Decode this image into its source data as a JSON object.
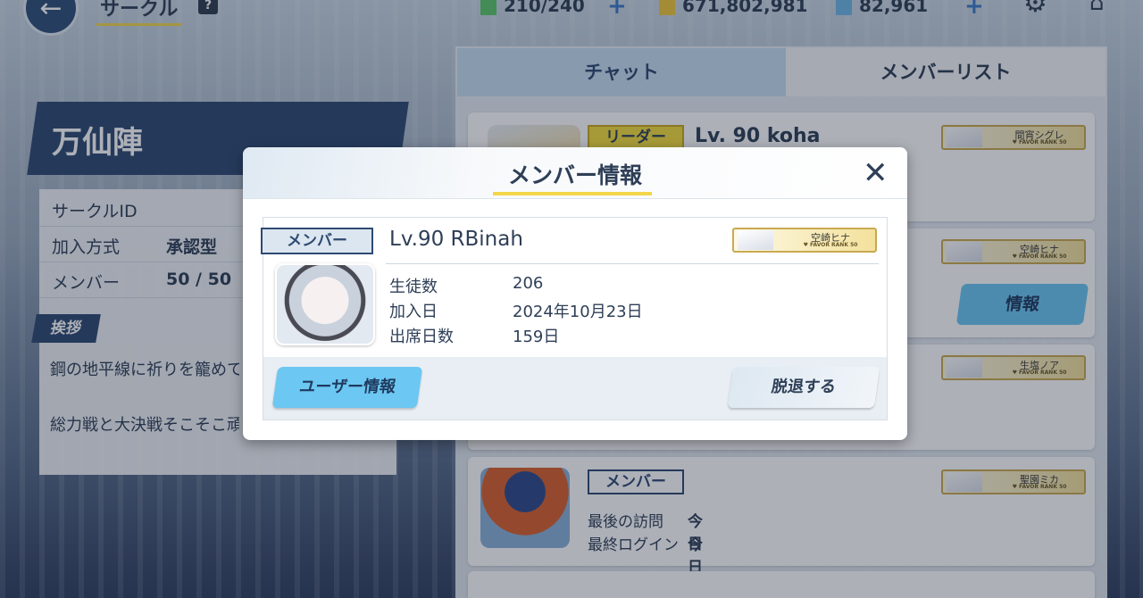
{
  "topbar": {
    "back_icon": "←",
    "title": "サークル",
    "help_icon": "?",
    "ap": "210/240",
    "credits": "671,802,981",
    "pyroxene": "82,961",
    "plus": "+",
    "settings_icon": "⚙",
    "home_icon": "⌂"
  },
  "circle": {
    "name": "万仙陣",
    "id_label": "サークルID",
    "join_label": "加入方式",
    "join_value": "承認型",
    "members_label": "メンバー",
    "members_value": "50 / 50",
    "greeting_label": "挨拶",
    "greeting_lines": [
      "鋼の地平線に祈りを籠めて",
      "総力戦と大決戦そこそこ頑"
    ]
  },
  "tabs": {
    "chat": "チャット",
    "members": "メンバーリスト"
  },
  "member_list": [
    {
      "role": "リーダー",
      "name": "Lv. 90 koha",
      "favor_student": "間宵シグレ"
    },
    {
      "favor_student": "空崎ヒナ",
      "info_button": "情報"
    },
    {
      "favor_student": "生塩ノア"
    },
    {
      "role": "メンバー",
      "favor_student": "聖園ミカ",
      "last_visit_label": "最後の訪問",
      "last_visit_value": "今日",
      "last_login_label": "最終ログイン",
      "last_login_value": "今日"
    }
  ],
  "favor_rank_text": "♥ FAVOR RANK 50",
  "modal": {
    "title": "メンバー情報",
    "close_icon": "✕",
    "role": "メンバー",
    "name": "Lv.90 RBinah",
    "favor_student": "空崎ヒナ",
    "students_label": "生徒数",
    "students_value": "206",
    "joined_label": "加入日",
    "joined_value": "2024年10月23日",
    "attendance_label": "出席日数",
    "attendance_value": "159日",
    "user_info_button": "ユーザー情報",
    "leave_button": "脱退する"
  },
  "colors": {
    "navy": "#2e4a72",
    "accent_yellow": "#f3d64a",
    "button_blue": "#6cc7f2",
    "leader_yellow": "#f5de3c"
  }
}
